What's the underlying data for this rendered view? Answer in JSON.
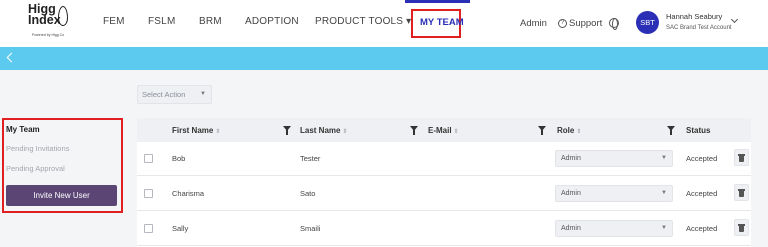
{
  "brand": {
    "logo_line1": "Higg",
    "logo_line2": "Index",
    "powered_by": "Powered by Higg Co"
  },
  "nav": {
    "items": [
      "FEM",
      "FSLM",
      "BRM",
      "ADOPTION",
      "PRODUCT TOOLS ▾"
    ],
    "active": "MY TEAM"
  },
  "header": {
    "admin": "Admin",
    "support": "Support",
    "user": {
      "initials": "SBT",
      "name": "Hannah Seabury",
      "account": "SAC Brand Test Account"
    }
  },
  "toolbar": {
    "select_action": "Select Action"
  },
  "sidebar": {
    "title": "My Team",
    "items": [
      "Pending Invitations",
      "Pending Approval"
    ],
    "invite_button": "Invite New User"
  },
  "table": {
    "columns": [
      "First Name",
      "Last Name",
      "E-Mail",
      "Role",
      "Status"
    ],
    "rows": [
      {
        "first": "Bob",
        "last": "Tester",
        "email": "",
        "role": "Admin",
        "status": "Accepted"
      },
      {
        "first": "Charisma",
        "last": "Sato",
        "email": "",
        "role": "Admin",
        "status": "Accepted"
      },
      {
        "first": "Sally",
        "last": "Smaili",
        "email": "",
        "role": "Admin",
        "status": "Accepted"
      }
    ]
  },
  "colors": {
    "accent": "#2a2fb5",
    "strip": "#5ccaee",
    "highlight": "#e02020",
    "button": "#5a4575"
  }
}
